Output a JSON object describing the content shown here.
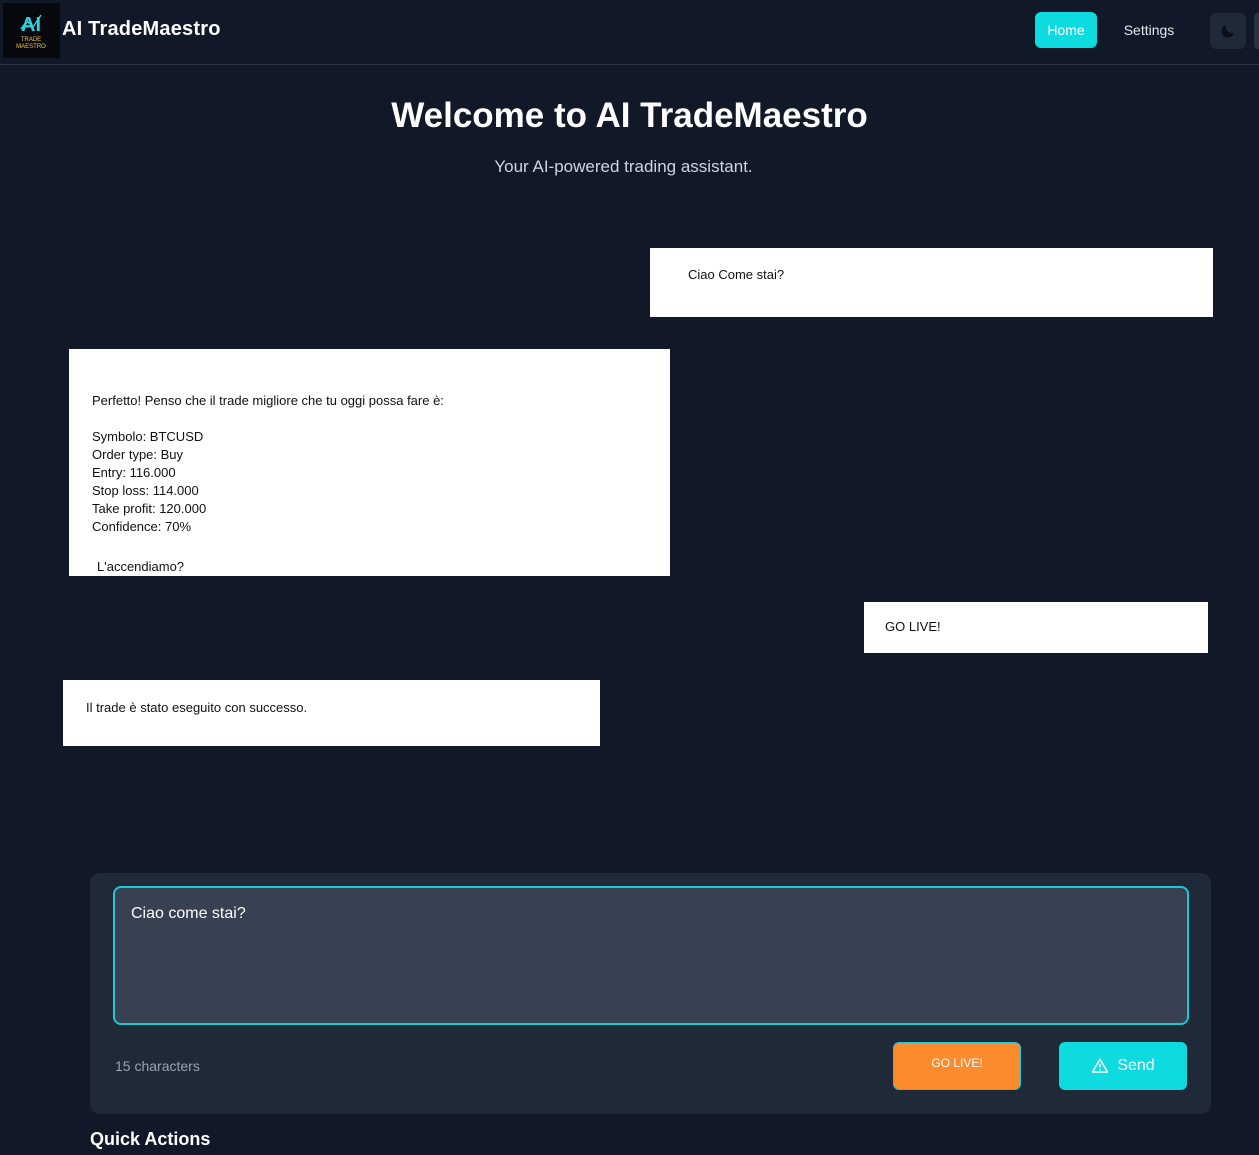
{
  "header": {
    "brand": "AI TradeMaestro",
    "logo_text": "TRADE MAESTRO",
    "nav": [
      {
        "label": "Home",
        "active": true
      },
      {
        "label": "Settings",
        "active": false
      }
    ],
    "theme_icon": "moon-icon"
  },
  "hero": {
    "title": "Welcome to AI TradeMaestro",
    "subtitle": "Your AI-powered trading assistant."
  },
  "messages": [
    {
      "role": "user",
      "text": "Ciao Come stai?"
    },
    {
      "role": "assistant",
      "text": "Perfetto! Penso che il trade migliore che tu oggi possa fare è:\n\nSymbolo: BTCUSD\nOrder type: Buy\nEntry: 116.000\nStop loss: 114.000\nTake profit: 120.000\nConfidence: 70%",
      "closing": "L'accendiamo?"
    },
    {
      "role": "user",
      "text": "GO LIVE!"
    },
    {
      "role": "assistant",
      "text": "Il trade è stato eseguito con successo."
    }
  ],
  "composer": {
    "value": "Ciao come stai?",
    "char_count": "15 characters",
    "go_live_label": "GO LIVE!",
    "send_label": "Send",
    "send_icon": "warning-triangle-icon"
  },
  "quick_actions": {
    "title": "Quick Actions"
  },
  "colors": {
    "background": "#111827",
    "accent": "#0ddbe0",
    "go_live": "#fb8b2c",
    "panel": "#1f2937"
  }
}
